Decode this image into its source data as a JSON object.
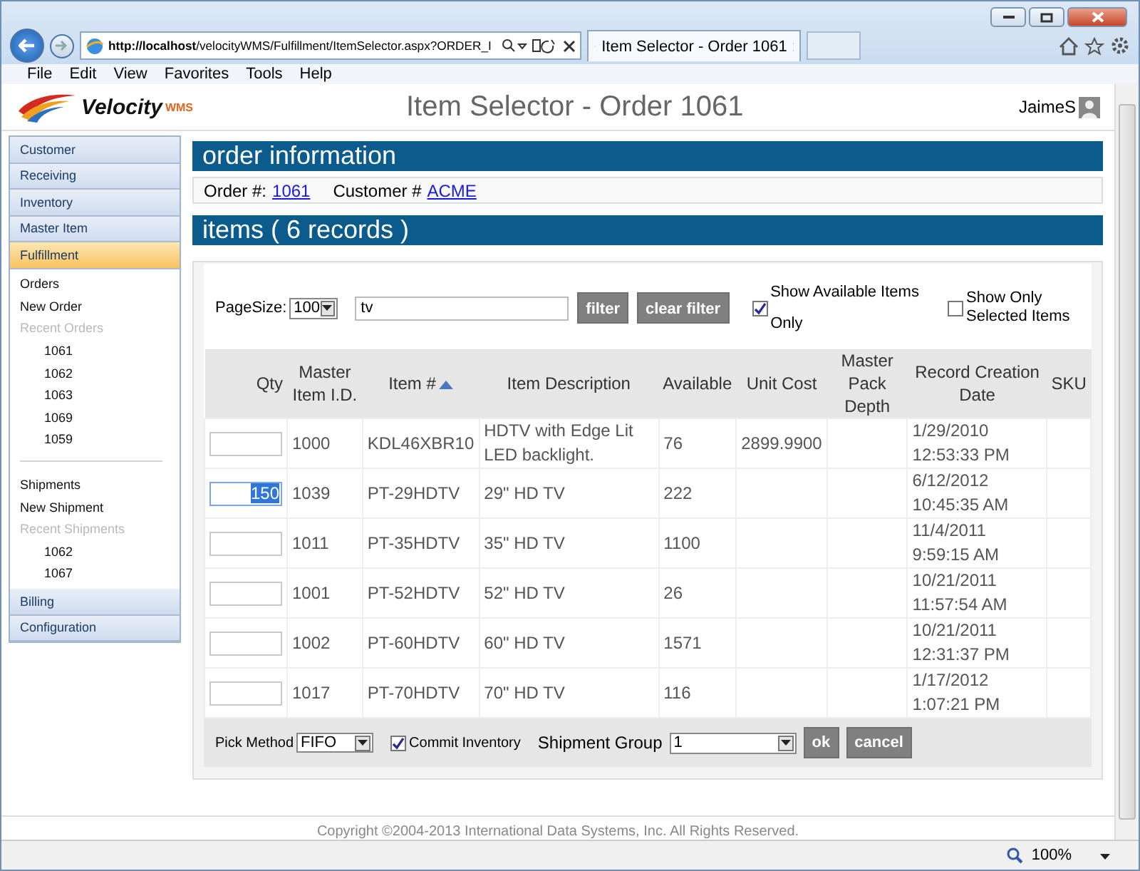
{
  "browser": {
    "url_host": "http://localhost",
    "url_path": "/velocityWMS/Fulfillment/ItemSelector.aspx?ORDER_I",
    "tab_title": "Item Selector - Order 1061",
    "menu": [
      "File",
      "Edit",
      "View",
      "Favorites",
      "Tools",
      "Help"
    ],
    "zoom": "100%"
  },
  "header": {
    "logo_name": "Velocity",
    "logo_suffix": "WMS",
    "title": "Item Selector - Order 1061",
    "user": "JaimeS"
  },
  "sidebar": {
    "sections": [
      {
        "label": "Customer",
        "selected": false
      },
      {
        "label": "Receiving",
        "selected": false
      },
      {
        "label": "Inventory",
        "selected": false
      },
      {
        "label": "Master Item",
        "selected": false
      },
      {
        "label": "Fulfillment",
        "selected": true,
        "groups": [
          {
            "items": [
              {
                "label": "Orders",
                "kind": "link"
              },
              {
                "label": "New Order",
                "kind": "link"
              },
              {
                "label": "Recent Orders",
                "kind": "heading",
                "children": [
                  {
                    "label": "1061"
                  },
                  {
                    "label": "1062"
                  },
                  {
                    "label": "1063"
                  },
                  {
                    "label": "1069"
                  },
                  {
                    "label": "1059"
                  }
                ]
              }
            ]
          },
          {
            "items": [
              {
                "label": "Shipments",
                "kind": "link"
              },
              {
                "label": "New Shipment",
                "kind": "link"
              },
              {
                "label": "Recent Shipments",
                "kind": "heading",
                "children": [
                  {
                    "label": "1062"
                  },
                  {
                    "label": "1067"
                  }
                ]
              }
            ]
          }
        ]
      },
      {
        "label": "Billing",
        "selected": false
      },
      {
        "label": "Configuration",
        "selected": false
      }
    ]
  },
  "order_info": {
    "heading": "order information",
    "order_label": "Order #:",
    "order_number": "1061",
    "customer_label": "Customer #",
    "customer": "ACME"
  },
  "items": {
    "heading": "items ( 6 records )",
    "page_size_label": "PageSize:",
    "page_size": "100",
    "filter_value": "tv",
    "filter_button": "filter",
    "clear_button": "clear filter",
    "checkboxes": [
      {
        "label": "Show Available Items Only",
        "checked": true
      },
      {
        "label": "Show Only Selected Items",
        "checked": false
      }
    ],
    "qty_column": "Qty",
    "columns": [
      "Master Item I.D.",
      "Item #",
      "Item Description",
      "Available",
      "Unit Cost",
      "Master Pack Depth",
      "Record Creation Date",
      "SKU"
    ],
    "rows": [
      {
        "qty": "",
        "focused": false,
        "cells": [
          "1000",
          "KDL46XBR10",
          "HDTV with Edge Lit LED backlight.",
          "76",
          "2899.9900",
          "",
          "1/29/2010 12:53:33 PM",
          ""
        ]
      },
      {
        "qty": "150",
        "focused": true,
        "cells": [
          "1039",
          "PT-29HDTV",
          "29\" HD TV",
          "222",
          "",
          "",
          "6/12/2012 10:45:35 AM",
          ""
        ]
      },
      {
        "qty": "",
        "focused": false,
        "cells": [
          "1011",
          "PT-35HDTV",
          "35\" HD TV",
          "1100",
          "",
          "",
          "11/4/2011 9:59:15 AM",
          ""
        ]
      },
      {
        "qty": "",
        "focused": false,
        "cells": [
          "1001",
          "PT-52HDTV",
          "52\" HD TV",
          "26",
          "",
          "",
          "10/21/2011 11:57:54 AM",
          ""
        ]
      },
      {
        "qty": "",
        "focused": false,
        "cells": [
          "1002",
          "PT-60HDTV",
          "60\" HD TV",
          "1571",
          "",
          "",
          "10/21/2011 12:31:37 PM",
          ""
        ]
      },
      {
        "qty": "",
        "focused": false,
        "cells": [
          "1017",
          "PT-70HDTV",
          "70\" HD TV",
          "116",
          "",
          "",
          "1/17/2012 1:07:21 PM",
          ""
        ]
      }
    ],
    "pick_method_label": "Pick Method",
    "pick_method": "FIFO",
    "commit": {
      "label": "Commit Inventory",
      "checked": true
    },
    "shipment_group_label": "Shipment Group",
    "shipment_group": "1",
    "ok_button": "ok",
    "cancel_button": "cancel"
  },
  "footer": {
    "copyright": "Copyright ©2004-2013 International Data Systems, Inc. All Rights Reserved."
  }
}
